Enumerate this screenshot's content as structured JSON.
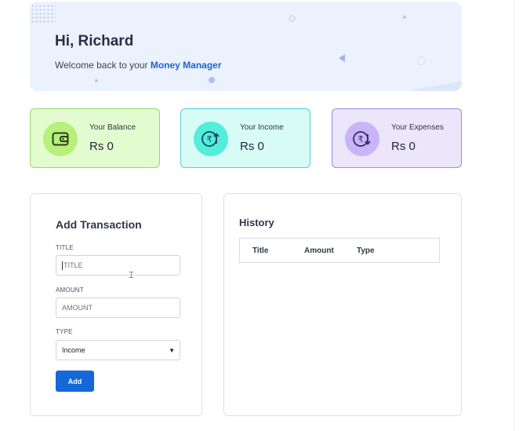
{
  "banner": {
    "greeting": "Hi, Richard",
    "welcome_prefix": "Welcome back to your ",
    "brand": "Money Manager"
  },
  "stats": {
    "balance": {
      "label": "Your Balance",
      "value": "Rs 0",
      "icon": "wallet-icon",
      "color": "#b7f07a"
    },
    "income": {
      "label": "Your Income",
      "value": "Rs 0",
      "icon": "rupee-income-icon",
      "color": "#52eddb"
    },
    "expenses": {
      "label": "Your Expenses",
      "value": "Rs 0",
      "icon": "rupee-expense-icon",
      "color": "#c8b4f6"
    }
  },
  "add_transaction": {
    "heading": "Add Transaction",
    "title_label": "TITLE",
    "title_placeholder": "TITLE",
    "amount_label": "AMOUNT",
    "amount_placeholder": "AMOUNT",
    "type_label": "TYPE",
    "type_selected": "Income",
    "add_button": "Add",
    "accent": "#1468d8"
  },
  "history": {
    "heading": "History",
    "columns": [
      "Title",
      "Amount",
      "Type"
    ]
  }
}
